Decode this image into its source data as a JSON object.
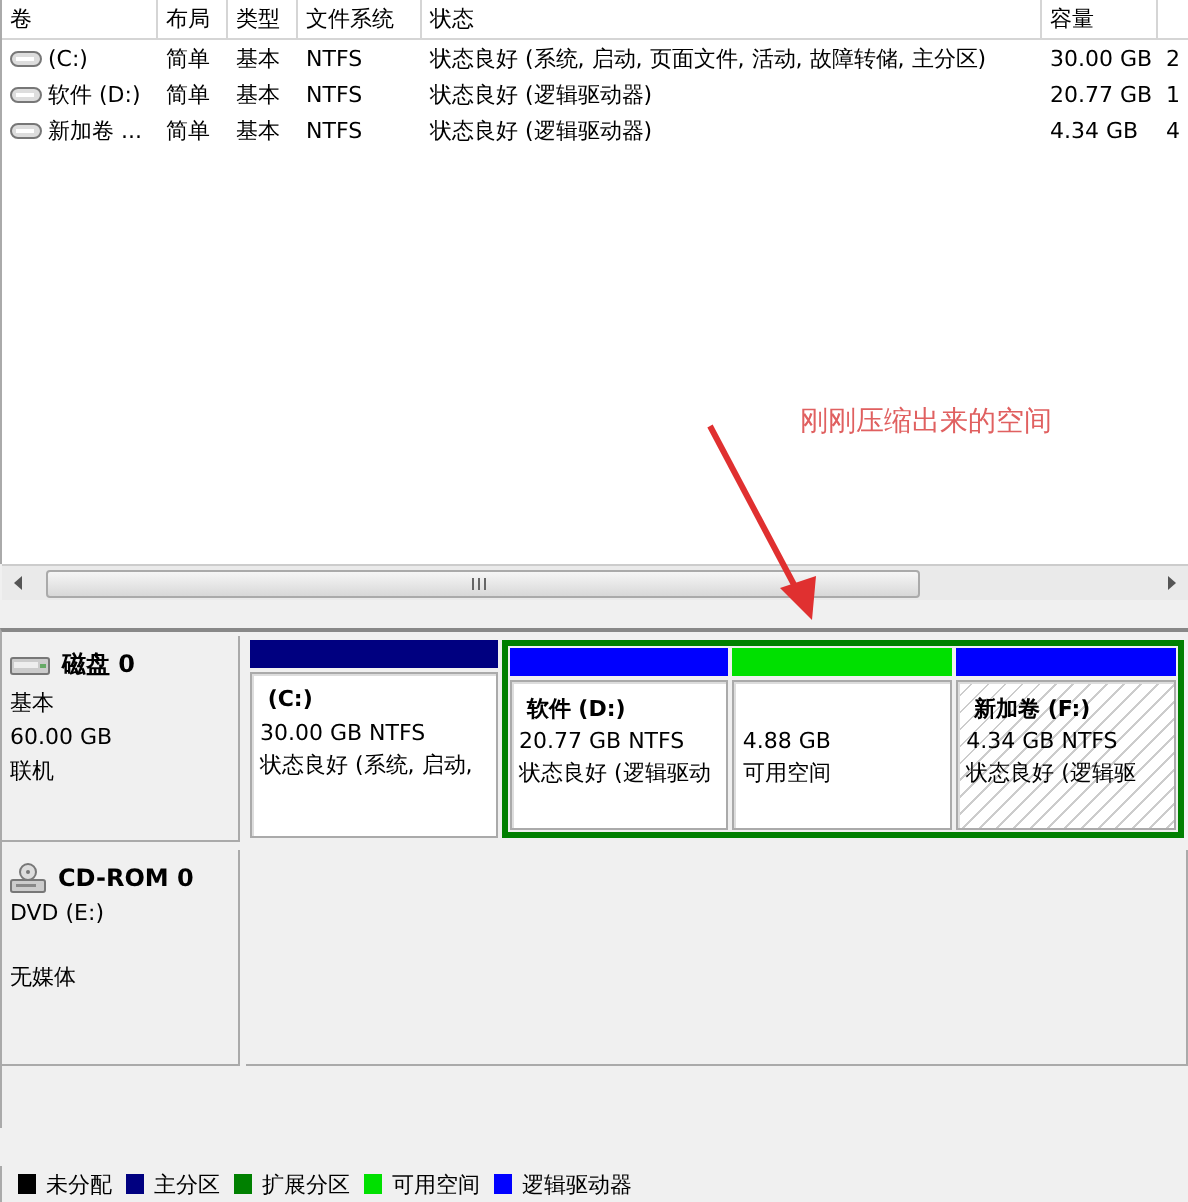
{
  "volume_table": {
    "columns": [
      "卷",
      "布局",
      "类型",
      "文件系统",
      "状态",
      "容量"
    ],
    "rows": [
      {
        "cells": [
          "(C:)",
          "简单",
          "基本",
          "NTFS",
          "状态良好 (系统, 启动, 页面文件, 活动, 故障转储, 主分区)",
          "30.00 GB",
          "2"
        ]
      },
      {
        "cells": [
          "软件 (D:)",
          "简单",
          "基本",
          "NTFS",
          "状态良好 (逻辑驱动器)",
          "20.77 GB",
          "1"
        ]
      },
      {
        "cells": [
          "新加卷 ...",
          "简单",
          "基本",
          "NTFS",
          "状态良好 (逻辑驱动器)",
          "4.34 GB",
          "4"
        ]
      }
    ]
  },
  "annotation": {
    "text": "刚刚压缩出来的空间"
  },
  "disks": [
    {
      "kind": "disk",
      "name": "磁盘 0",
      "lines": [
        "基本",
        "60.00 GB",
        "联机"
      ],
      "partitions": [
        {
          "kind": "partition",
          "title": "(C:)",
          "lines": [
            "30.00 GB NTFS",
            "状态良好 (系统, 启动,"
          ],
          "color": "#000080",
          "selected": false
        },
        {
          "kind": "extended",
          "color": "#008000",
          "partitions": [
            {
              "kind": "partition",
              "title": "软件  (D:)",
              "lines": [
                "20.77 GB NTFS",
                "状态良好 (逻辑驱动"
              ],
              "color": "#0000ff",
              "selected": false
            },
            {
              "kind": "partition",
              "lines": [
                "4.88 GB",
                "可用空间"
              ],
              "color": "#00e000",
              "selected": false
            },
            {
              "kind": "partition",
              "title": "新加卷  (F:)",
              "lines": [
                "4.34 GB NTFS",
                "状态良好 (逻辑驱"
              ],
              "color": "#0000ff",
              "selected": true
            }
          ]
        }
      ]
    },
    {
      "kind": "cdrom",
      "name": "CD-ROM 0",
      "lines": [
        "DVD (E:)",
        "无媒体"
      ]
    }
  ],
  "legend": [
    {
      "label": "未分配",
      "color": "#000000"
    },
    {
      "label": "主分区",
      "color": "#000080"
    },
    {
      "label": "扩展分区",
      "color": "#008000"
    },
    {
      "label": "可用空间",
      "color": "#00e000"
    },
    {
      "label": "逻辑驱动器",
      "color": "#0000ff"
    }
  ]
}
